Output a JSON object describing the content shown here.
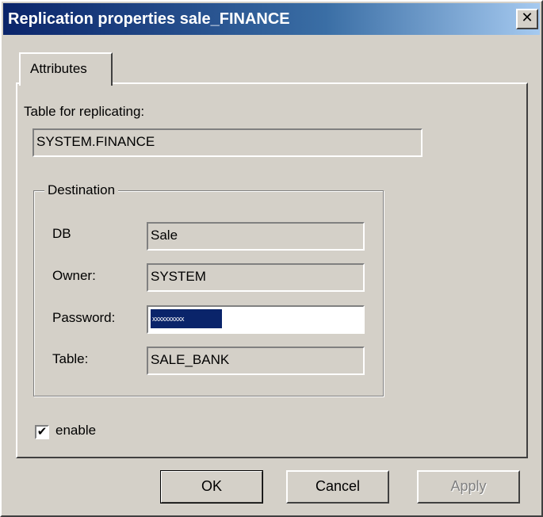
{
  "window": {
    "title": "Replication properties sale_FINANCE",
    "close_glyph": "✕"
  },
  "tabs": [
    {
      "label": "Attributes",
      "active": true
    }
  ],
  "attributes": {
    "table_label": "Table for replicating:",
    "table_value": "SYSTEM.FINANCE",
    "destination": {
      "legend": "Destination",
      "db_label": "DB",
      "db_value": "Sale",
      "owner_label": "Owner:",
      "owner_value": "SYSTEM",
      "password_label": "Password:",
      "password_value": "xxxxxxxxxx",
      "table_label": "Table:",
      "table_value": "SALE_BANK"
    },
    "enable_label": "enable",
    "enable_checked": true,
    "check_glyph": "✔"
  },
  "buttons": {
    "ok": "OK",
    "cancel": "Cancel",
    "apply": "Apply"
  }
}
